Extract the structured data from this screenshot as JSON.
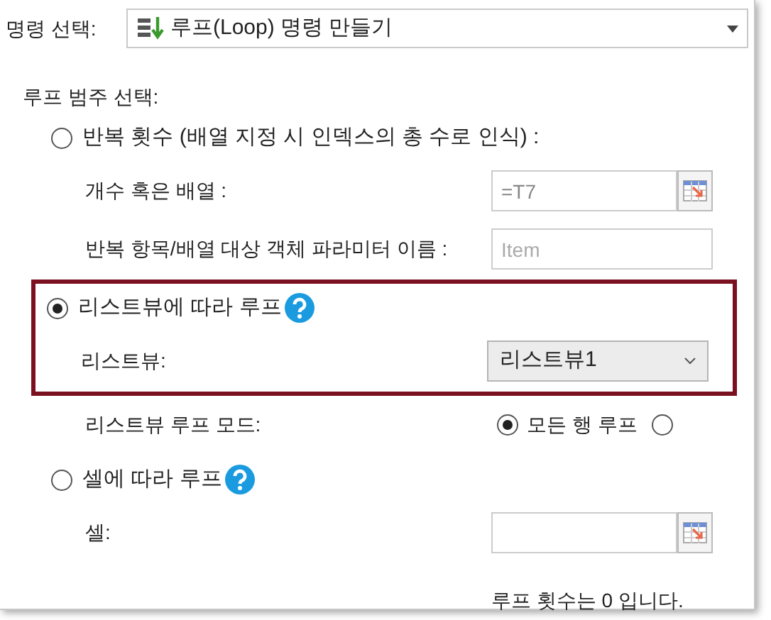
{
  "command": {
    "label": "명령 선택:",
    "value": "루프(Loop) 명령 만들기"
  },
  "category_label": "루프 범주 선택:",
  "options": [
    {
      "label": "반복 횟수 (배열 지정 시 인덱스의 총 수로 인식) :",
      "selected": false,
      "help": false,
      "highlighted": false,
      "fields": [
        {
          "kind": "range",
          "label": "개수 혹은 배열 :",
          "placeholder": "=T7"
        },
        {
          "kind": "text",
          "label": "반복 항목/배열 대상 객체 파라미터 이름 :",
          "placeholder": "Item"
        }
      ]
    },
    {
      "label": "리스트뷰에 따라 루프",
      "selected": true,
      "help": true,
      "highlighted": true,
      "fields": [
        {
          "kind": "select",
          "label": "리스트뷰:",
          "value": "리스트뷰1"
        }
      ],
      "after": [
        {
          "kind": "radios",
          "label": "리스트뷰 루프 모드:",
          "choices": [
            {
              "label": "모든 행 루프",
              "selected": true
            },
            {
              "selected": false
            }
          ]
        }
      ]
    },
    {
      "label": "셀에 따라 루프",
      "selected": false,
      "help": true,
      "highlighted": false,
      "fields": [
        {
          "kind": "range",
          "label": "셀:"
        }
      ]
    }
  ],
  "summary": "루프 횟수는 0 입니다."
}
